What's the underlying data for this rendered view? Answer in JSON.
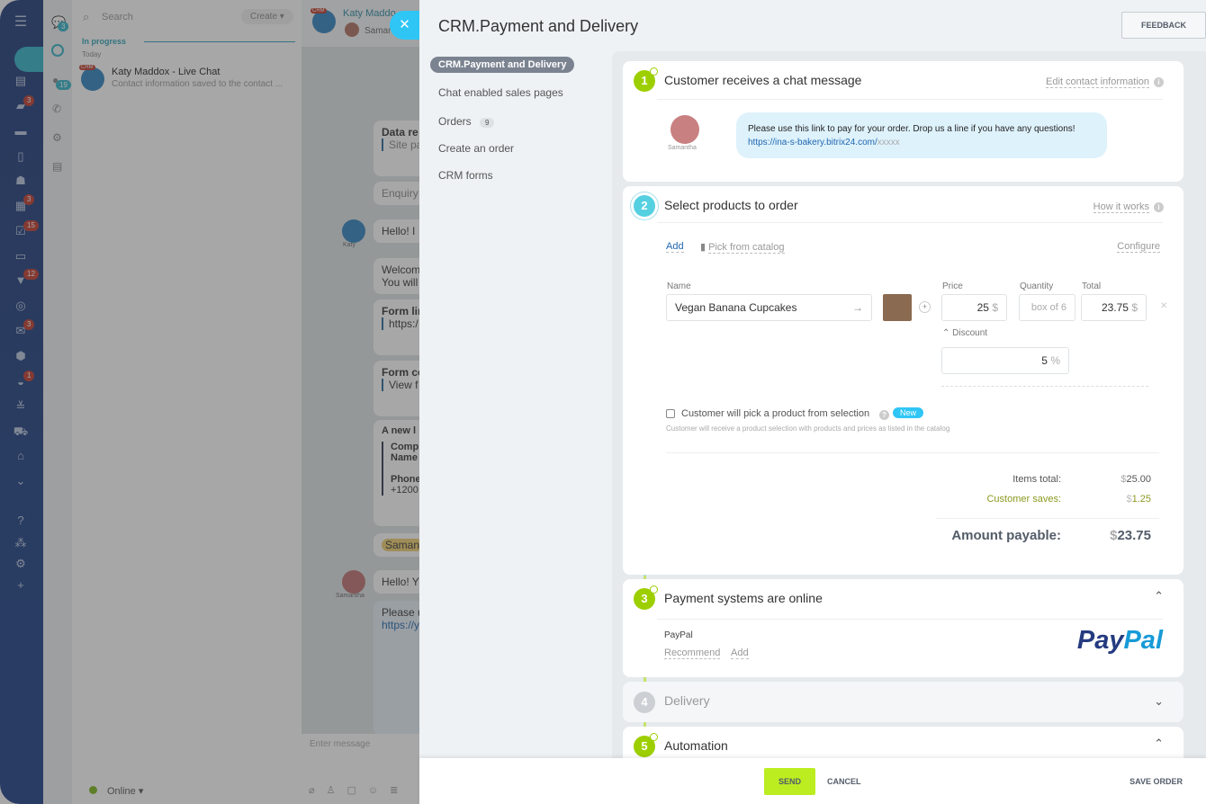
{
  "leftnav": {
    "badges": [
      "3",
      "3",
      "15",
      "12",
      "3",
      "1"
    ],
    "icons": [
      "menu-icon",
      "feed-icon",
      "chat-icon",
      "drive-icon",
      "docs-icon",
      "team-icon",
      "calendar-icon",
      "tasks-icon",
      "contacts-icon",
      "crm-funnel-icon",
      "target-icon",
      "mail-icon",
      "box-icon",
      "robot-icon",
      "settings-sliders-icon",
      "cart-icon",
      "store-icon",
      "more-icon",
      "help-icon",
      "sitemap-icon",
      "gear-icon",
      "plus-icon"
    ]
  },
  "iconcol": {
    "chat_badge": "3",
    "openlines_badge": "19"
  },
  "chatlist": {
    "search_placeholder": "Search",
    "create_label": "Create",
    "section": "In progress",
    "day": "Today",
    "item": {
      "tag": "CRM",
      "title": "Katy Maddox - Live Chat",
      "subtitle": "Contact information saved to the contact ..."
    },
    "status": "Online"
  },
  "chat": {
    "tag": "CRM",
    "title": "Katy Maddo",
    "subtitle": "Samar",
    "messages": [
      "Data re",
      "Site pa",
      "Enquiry",
      "Hello! I",
      "Welcom",
      "You will",
      "Form lir",
      "https:/",
      "Form co",
      "View f",
      "A new l",
      "Comp",
      "Name",
      "Phone",
      "+1200",
      "Saman",
      "Hello! Y",
      "Please u",
      "https://y"
    ],
    "avatars": [
      "Katy",
      "Samantha"
    ],
    "input_placeholder": "Enter message"
  },
  "slider": {
    "title": "CRM.Payment and Delivery",
    "feedback": "FEEDBACK",
    "menu": [
      {
        "label": "CRM.Payment and Delivery",
        "active": true
      },
      {
        "label": "Chat enabled sales pages"
      },
      {
        "label": "Orders",
        "count": "9"
      },
      {
        "label": "Create an order"
      },
      {
        "label": "CRM forms"
      }
    ],
    "step1": {
      "num": "1",
      "title": "Customer receives a chat message",
      "action": "Edit contact information",
      "sender": "Samantha",
      "message": "Please use this link to pay for your order. Drop us a line if you have any questions! ",
      "link": "https://ina-s-bakery.bitrix24.com/",
      "link_suffix": "xxxxx"
    },
    "step2": {
      "num": "2",
      "title": "Select products to order",
      "action": "How it works",
      "add": "Add",
      "pick": "Pick from catalog",
      "configure": "Configure",
      "labels": {
        "name": "Name",
        "price": "Price",
        "quantity": "Quantity",
        "total": "Total",
        "discount": "Discount"
      },
      "product": {
        "name": "Vegan Banana Cupcakes",
        "price": "25",
        "currency": "$",
        "quantity": "box of 6",
        "total": "23.75",
        "discount": "5",
        "discount_unit": "%"
      },
      "selection_label": "Customer will pick a product from selection",
      "selection_checked": false,
      "new_badge": "New",
      "selection_hint": "Customer will receive a product selection with products and prices as listed in the catalog",
      "items_total_label": "Items total:",
      "items_total": "25.00",
      "saves_label": "Customer saves:",
      "saves": "1.25",
      "payable_label": "Amount payable:",
      "payable": "23.75"
    },
    "step3": {
      "num": "3",
      "title": "Payment systems are online",
      "system": "PayPal",
      "recommend": "Recommend",
      "add": "Add",
      "logo": "PayPal"
    },
    "step4": {
      "num": "4",
      "title": "Delivery"
    },
    "step5": {
      "num": "5",
      "title": "Automation"
    },
    "footer": {
      "send": "SEND",
      "cancel": "CANCEL",
      "save": "SAVE ORDER"
    }
  },
  "colors": {
    "accent_green": "#9dcf00",
    "accent_blue": "#2fc6f6",
    "step2_blue": "#55d0e0",
    "link": "#2067b0",
    "saves": "#8c9a20"
  }
}
